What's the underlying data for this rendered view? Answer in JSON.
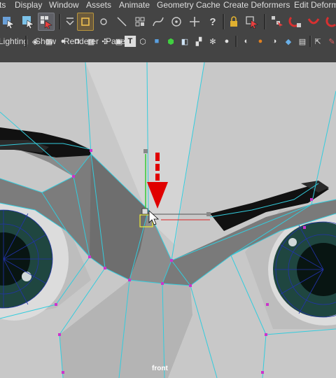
{
  "menus": [
    "ts",
    "Display",
    "Window",
    "Assets",
    "Animate",
    "Geometry Cache",
    "Create Deformers",
    "Edit Deforme"
  ],
  "panel_menus": [
    "Lighting",
    "Show",
    "Renderer",
    "Panels"
  ],
  "viewport": {
    "camera_label": "front"
  },
  "toolbar": {
    "icons": [
      "select-icon",
      "lasso-icon",
      "paint-select-icon",
      "snap-toggle-icon",
      "square-icon",
      "circle-icon",
      "line-icon",
      "grid-icon",
      "curve-icon",
      "target-icon",
      "move-icon",
      "help-icon",
      "lock-icon",
      "select-mode-icon",
      "constraint-icon",
      "magnet-icon",
      "curve-magnet-icon",
      "point-magnet-icon"
    ]
  },
  "colors": {
    "ui_background": "#444444",
    "viewport_background": "#c9c9c9",
    "wireframe": "#33ccdd",
    "vertex": "#cc33cc",
    "manipulator_y": "#33cc33",
    "manipulator_x": "#dd2222",
    "annotation_arrow": "#e00000"
  }
}
